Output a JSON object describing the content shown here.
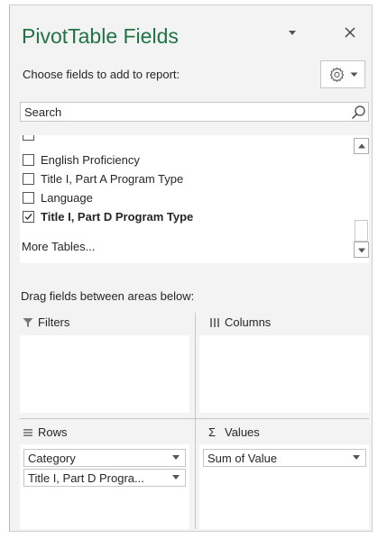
{
  "header": {
    "title": "PivotTable Fields",
    "choose_label": "Choose fields to add to report:",
    "tools_icon": "gear-icon"
  },
  "search": {
    "placeholder": "Search"
  },
  "fields": [
    {
      "label": "English Proficiency",
      "checked": false,
      "bold": false
    },
    {
      "label": "Title I, Part A Program Type",
      "checked": false,
      "bold": false
    },
    {
      "label": "Language",
      "checked": false,
      "bold": false
    },
    {
      "label": "Title I, Part D Program Type",
      "checked": true,
      "bold": true
    }
  ],
  "more_tables": "More Tables...",
  "drag_label": "Drag fields between areas below:",
  "areas": {
    "filters": {
      "title": "Filters",
      "items": []
    },
    "columns": {
      "title": "Columns",
      "items": []
    },
    "rows": {
      "title": "Rows",
      "items": [
        "Category",
        "Title I, Part D Progra..."
      ]
    },
    "values": {
      "title": "Values",
      "items": [
        "Sum of Value"
      ]
    }
  },
  "colors": {
    "title": "#217346",
    "pane_background": "#f3f3f3"
  }
}
